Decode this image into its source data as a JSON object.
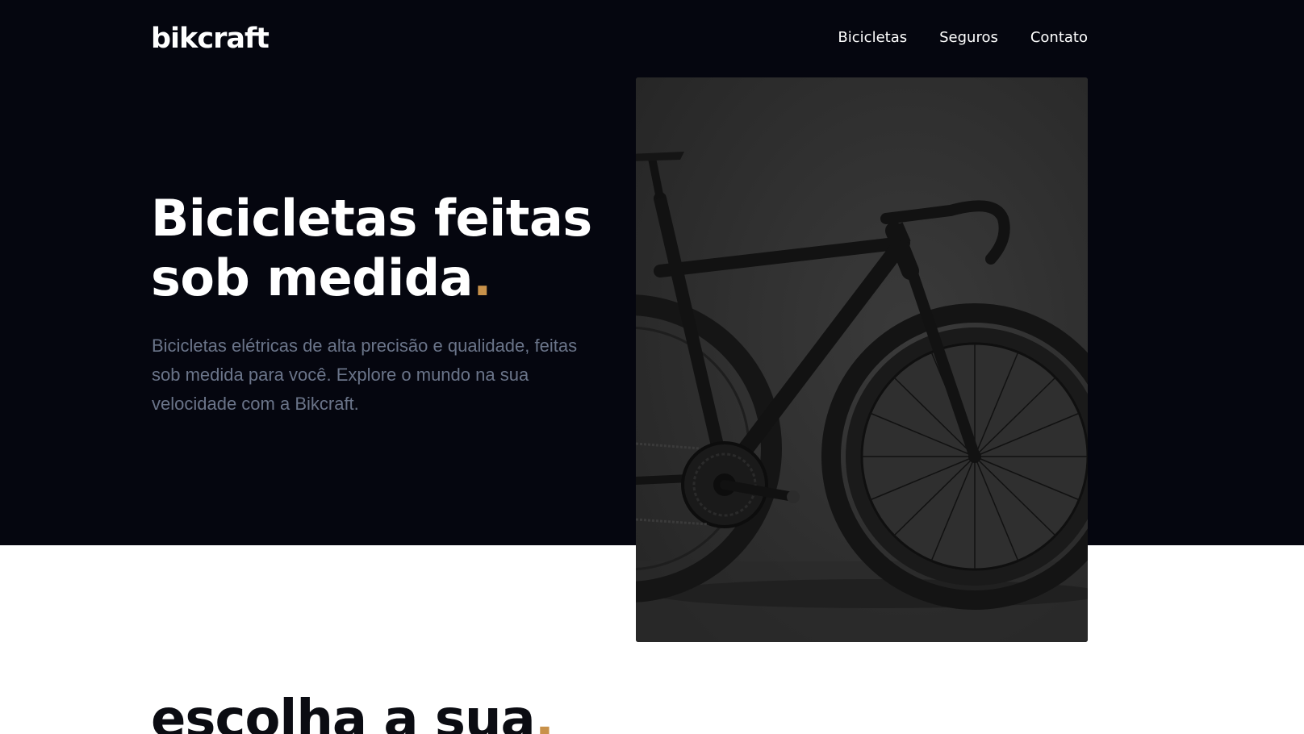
{
  "brand": {
    "name": "bikcraft"
  },
  "nav": {
    "items": [
      {
        "label": "Bicicletas"
      },
      {
        "label": "Seguros"
      },
      {
        "label": "Contato"
      }
    ]
  },
  "hero": {
    "title_line1": "Bicicletas feitas",
    "title_line2": "sob medida",
    "title_dot": ".",
    "subtitle": "Bicicletas elétricas de alta precisão e qualidade, feitas sob medida para você. Explore o mundo na sua velocidade com a Bikcraft.",
    "image_icon": "bicycle-photo"
  },
  "section": {
    "title": "escolha a sua",
    "title_dot": "."
  },
  "colors": {
    "hero_background": "#05060f",
    "accent": "#c8914a",
    "subtitle_text": "#6a7489",
    "page_background": "#ffffff"
  }
}
